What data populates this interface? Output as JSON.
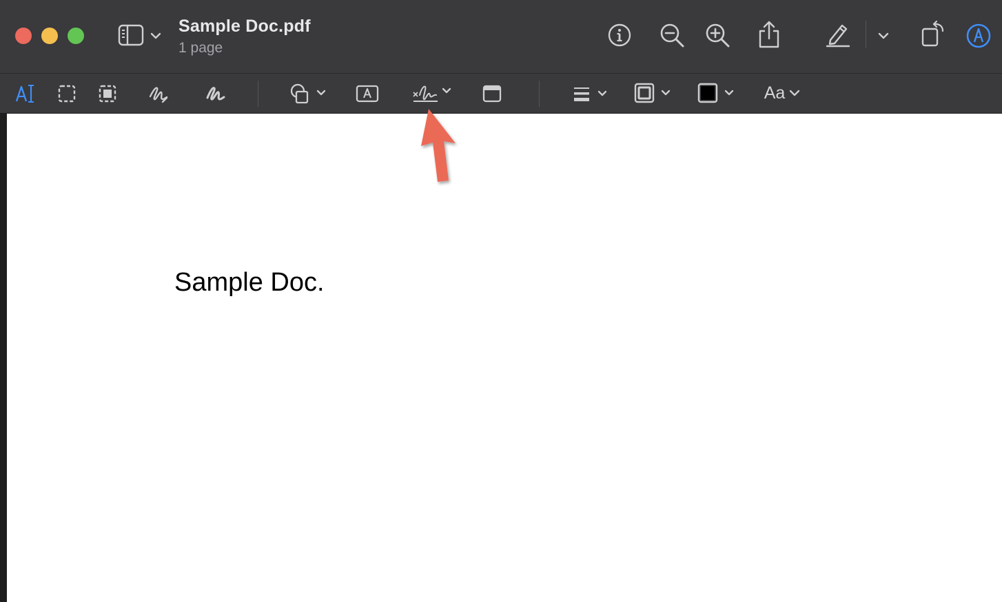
{
  "window": {
    "title": "Sample Doc.pdf",
    "subtitle": "1 page"
  },
  "toolbar": {
    "icons": [
      "sidebar-icon",
      "chevron-down-icon",
      "info-icon",
      "zoom-out-icon",
      "zoom-in-icon",
      "share-icon",
      "highlight-icon",
      "chevron-down-icon",
      "rotate-icon",
      "markup-icon"
    ]
  },
  "markup_toolbar": {
    "icons": [
      "text-selection-icon",
      "rectangular-selection-icon",
      "instant-alpha-icon",
      "sketch-icon",
      "draw-icon",
      "shapes-icon",
      "text-box-icon",
      "signature-icon",
      "note-icon",
      "line-style-icon",
      "border-color-icon",
      "fill-color-icon",
      "text-style-icon"
    ],
    "text_style_label": "Aa",
    "fill_color": "#000000",
    "accent_color": "#3f8ef7"
  },
  "document": {
    "text": "Sample Doc."
  },
  "annotation": {
    "arrow_color": "#ea6a57"
  }
}
